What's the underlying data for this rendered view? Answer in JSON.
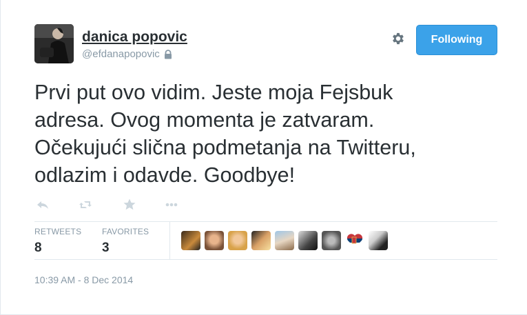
{
  "user": {
    "display_name": "danica popovic",
    "handle": "@efdanapopovic",
    "protected": true
  },
  "header": {
    "follow_label": "Following",
    "settings_icon": "gear-icon"
  },
  "tweet": {
    "lines": [
      "Prvi put ovo vidim. Jeste moja Fejsbuk",
      "adresa. Ovog momenta je zatvaram.",
      "Očekujući slična podmetanja na Twitteru,",
      "odlazim i odavde. Goodbye!"
    ]
  },
  "actions": [
    "reply-icon",
    "retweet-icon",
    "favorite-icon",
    "more-icon"
  ],
  "stats": {
    "retweets_label": "RETWEETS",
    "retweets_value": "8",
    "favorites_label": "FAVORITES",
    "favorites_value": "3"
  },
  "favoriters": [
    "favoriter-avatar-1",
    "favoriter-avatar-2",
    "favoriter-avatar-3",
    "favoriter-avatar-4",
    "favoriter-avatar-5",
    "favoriter-avatar-6",
    "favoriter-avatar-7",
    "favoriter-avatar-8",
    "favoriter-avatar-9"
  ],
  "timestamp": "10:39 AM - 8 Dec 2014",
  "colors": {
    "accent": "#55acee",
    "text": "#292f33",
    "muted": "#8899a6"
  }
}
